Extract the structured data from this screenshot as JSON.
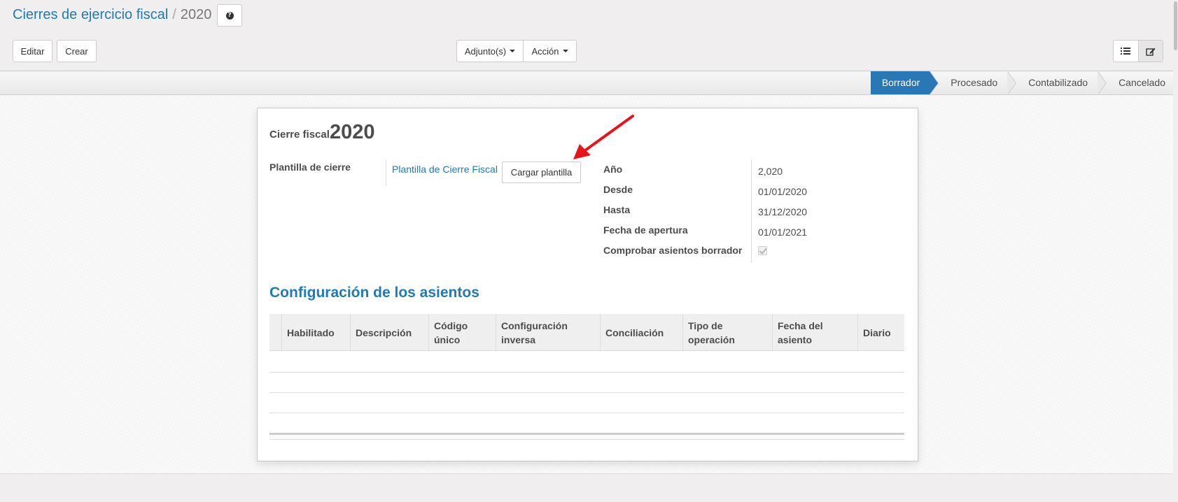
{
  "breadcrumb": {
    "parent": "Cierres de ejercicio fiscal",
    "separator": "/",
    "current": "2020"
  },
  "toolbar": {
    "edit_label": "Editar",
    "create_label": "Crear",
    "attachments_label": "Adjunto(s)",
    "action_label": "Acción"
  },
  "view_switcher": {
    "icons": [
      "list-view-icon",
      "form-view-icon"
    ],
    "active": "form-view-icon"
  },
  "statusbar": {
    "stages": [
      "Borrador",
      "Procesado",
      "Contabilizado",
      "Cancelado"
    ],
    "active": "Borrador",
    "active_color": "#2a77b6"
  },
  "form": {
    "title_label": "Cierre fiscal",
    "title_value": "2020",
    "template_label": "Plantilla de cierre",
    "template_value": "Plantilla de Cierre Fiscal",
    "load_template_label": "Cargar plantilla",
    "fields": [
      {
        "label": "Año",
        "value": "2,020"
      },
      {
        "label": "Desde",
        "value": "01/01/2020"
      },
      {
        "label": "Hasta",
        "value": "31/12/2020"
      },
      {
        "label": "Fecha de apertura",
        "value": "01/01/2021"
      },
      {
        "label": "Comprobar asientos borrador",
        "value": "checked"
      }
    ]
  },
  "moves_section": {
    "title": "Configuración de los asientos",
    "columns": [
      {
        "line1": "Habilitado",
        "line2": ""
      },
      {
        "line1": "Descripción",
        "line2": ""
      },
      {
        "line1": "Código",
        "line2": "único"
      },
      {
        "line1": "Configuración",
        "line2": "inversa"
      },
      {
        "line1": "Conciliación",
        "line2": ""
      },
      {
        "line1": "Tipo de",
        "line2": "operación"
      },
      {
        "line1": "Fecha del",
        "line2": "asiento"
      },
      {
        "line1": "Diario",
        "line2": ""
      }
    ],
    "rows": []
  },
  "colors": {
    "link": "#1f7ab7",
    "annotation_arrow": "#e8141b"
  }
}
